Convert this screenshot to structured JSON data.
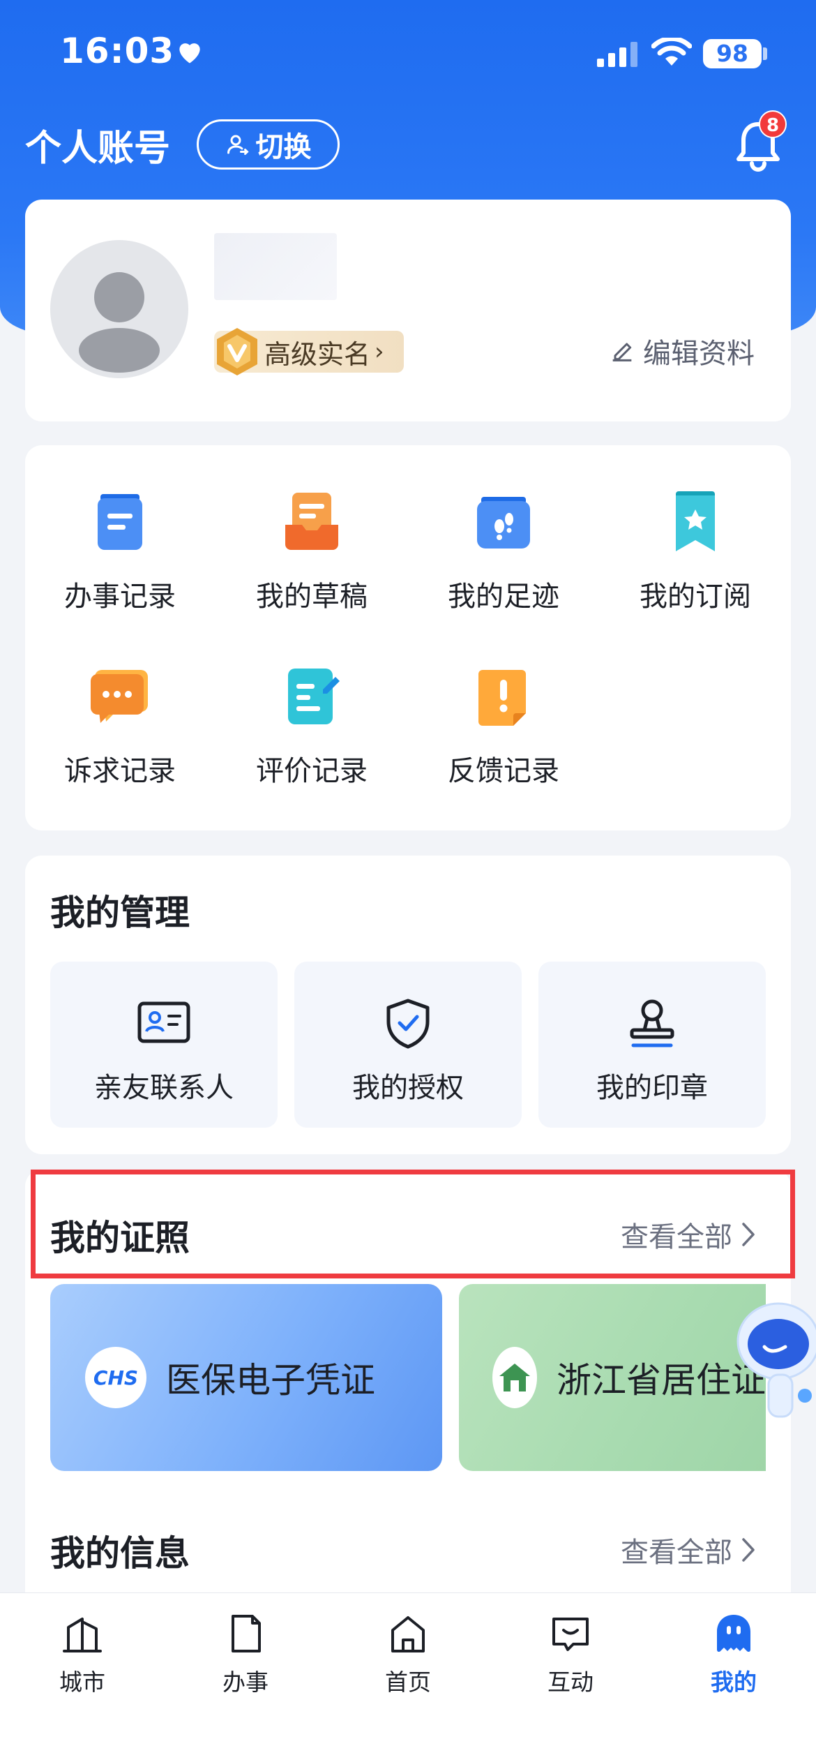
{
  "status_bar": {
    "time": "16:03",
    "battery": "98"
  },
  "header": {
    "title": "个人账号",
    "switch_label": "切换",
    "notification_count": "8"
  },
  "profile": {
    "verify_label": "高级实名",
    "edit_label": "编辑资料"
  },
  "quick_grid": {
    "items": [
      {
        "label": "办事记录",
        "icon": "service-record-icon"
      },
      {
        "label": "我的草稿",
        "icon": "draft-icon"
      },
      {
        "label": "我的足迹",
        "icon": "footprint-icon"
      },
      {
        "label": "我的订阅",
        "icon": "subscription-icon"
      },
      {
        "label": "诉求记录",
        "icon": "appeal-record-icon"
      },
      {
        "label": "评价记录",
        "icon": "review-record-icon"
      },
      {
        "label": "反馈记录",
        "icon": "feedback-record-icon"
      }
    ]
  },
  "management": {
    "title": "我的管理",
    "tiles": [
      {
        "label": "亲友联系人",
        "icon": "contact-card-icon"
      },
      {
        "label": "我的授权",
        "icon": "authorization-shield-icon"
      },
      {
        "label": "我的印章",
        "icon": "seal-stamp-icon"
      }
    ]
  },
  "licenses": {
    "title": "我的证照",
    "view_all": "查看全部",
    "cards": [
      {
        "name": "医保电子凭证",
        "logo_text": "CHS"
      },
      {
        "name": "浙江省居住证"
      }
    ]
  },
  "info": {
    "title": "我的信息",
    "view_all": "查看全部"
  },
  "tabbar": {
    "tabs": [
      {
        "label": "城市",
        "icon": "city-icon"
      },
      {
        "label": "办事",
        "icon": "document-icon"
      },
      {
        "label": "首页",
        "icon": "home-icon"
      },
      {
        "label": "互动",
        "icon": "chat-icon"
      },
      {
        "label": "我的",
        "icon": "my-profile-icon",
        "active": true
      }
    ]
  },
  "colors": {
    "primary": "#1f6cf0",
    "highlight": "#ef3b40",
    "badge": "#f23a3a"
  }
}
